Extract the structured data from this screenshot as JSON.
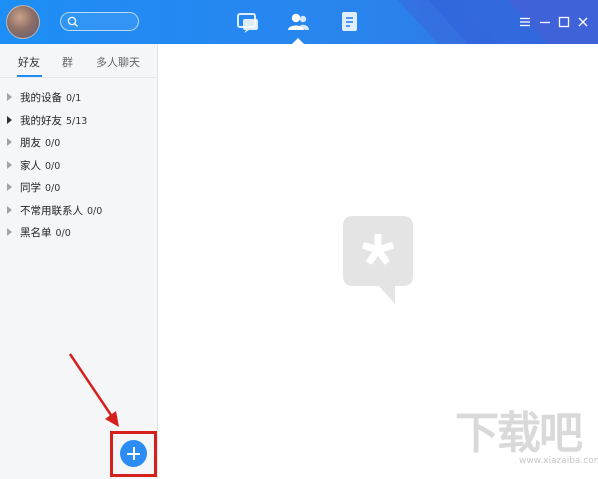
{
  "search": {
    "placeholder": ""
  },
  "topnav": [
    {
      "name": "messages",
      "active": false
    },
    {
      "name": "contacts",
      "active": true
    },
    {
      "name": "files",
      "active": false
    }
  ],
  "sidebar": {
    "tabs": [
      {
        "label": "好友",
        "active": true
      },
      {
        "label": "群",
        "active": false
      },
      {
        "label": "多人聊天",
        "active": false
      }
    ],
    "groups": [
      {
        "name": "我的设备",
        "count": "0/1"
      },
      {
        "name": "我的好友",
        "count": "5/13"
      },
      {
        "name": "朋友",
        "count": "0/0"
      },
      {
        "name": "家人",
        "count": "0/0"
      },
      {
        "name": "同学",
        "count": "0/0"
      },
      {
        "name": "不常用联系人",
        "count": "0/0"
      },
      {
        "name": "黑名单",
        "count": "0/0"
      }
    ]
  },
  "watermark": {
    "main": "下载吧",
    "sub": "www.xiazaiba.com"
  },
  "colors": {
    "brand": "#1e8df4",
    "annotation": "#d6201b"
  }
}
